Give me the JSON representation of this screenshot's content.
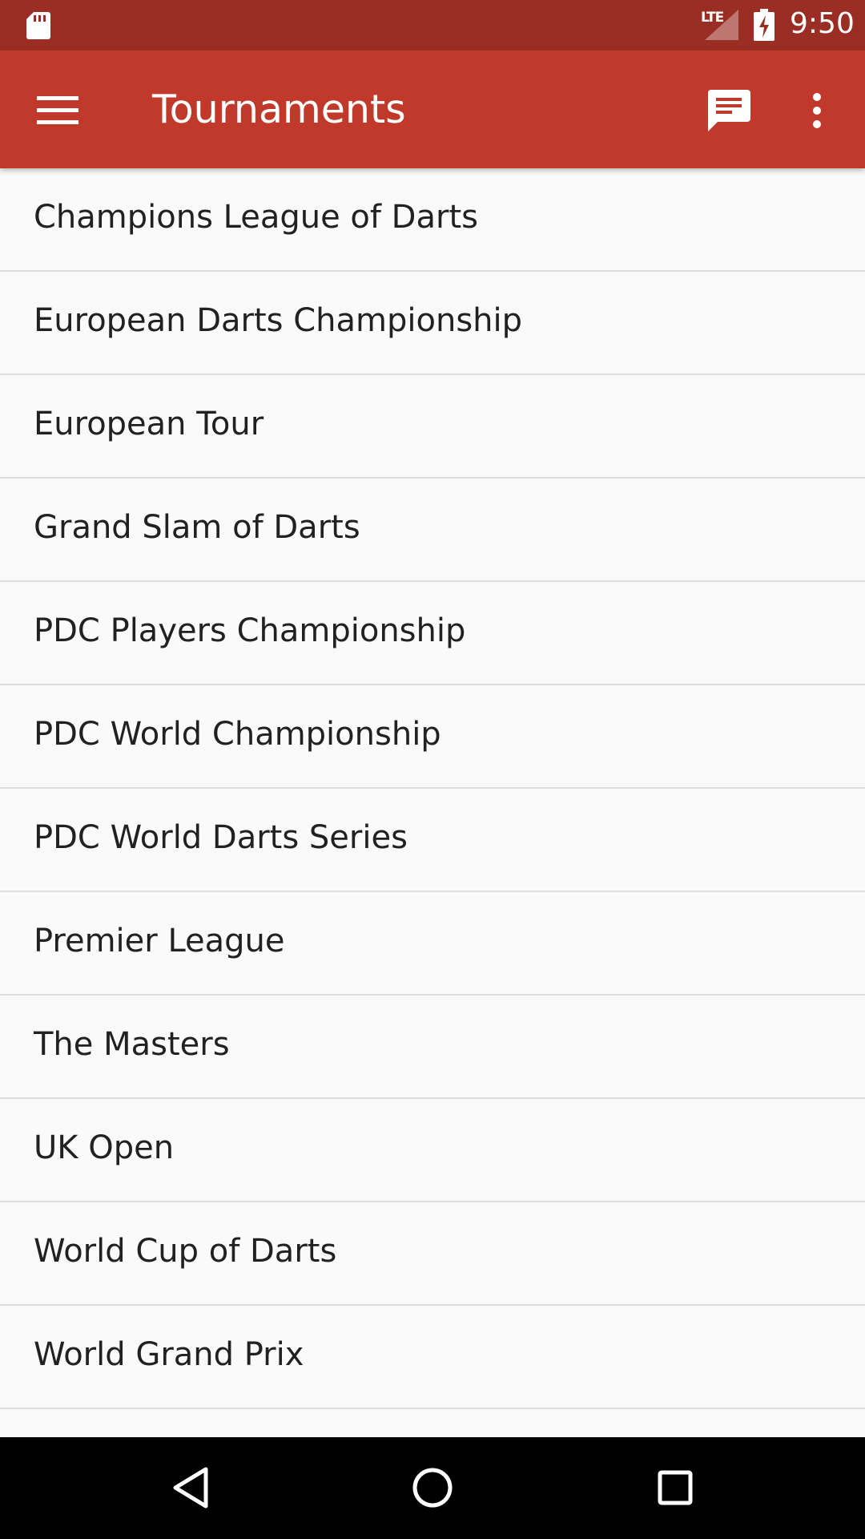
{
  "status_bar": {
    "network_label": "LTE",
    "time": "9:50",
    "icons": [
      "sd-card-icon",
      "signal-icon",
      "battery-charging-icon"
    ],
    "background_color": "#9b2e24"
  },
  "toolbar": {
    "title": "Tournaments",
    "background_color": "#c0392b",
    "icons": [
      "menu-icon",
      "message-icon",
      "more-vert-icon"
    ]
  },
  "tournaments": [
    "Champions League of Darts",
    "European Darts Championship",
    "European Tour",
    "Grand Slam of Darts",
    "PDC Players Championship",
    "PDC World Championship",
    "PDC World Darts Series",
    "Premier League",
    "The Masters",
    "UK Open",
    "World Cup of Darts",
    "World Grand Prix",
    ""
  ],
  "nav_bar": {
    "icons": [
      "back-icon",
      "home-icon",
      "recents-icon"
    ]
  }
}
